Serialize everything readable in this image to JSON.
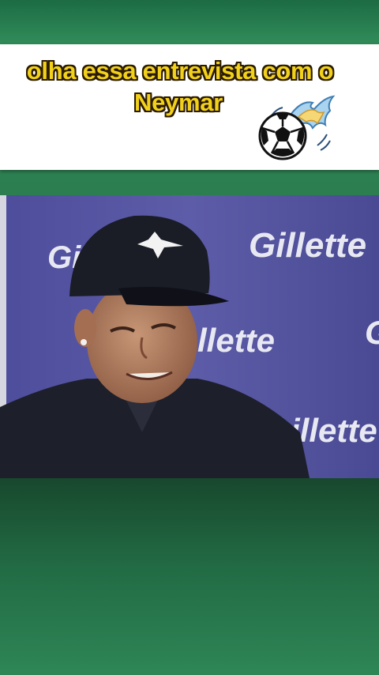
{
  "caption": {
    "line1": "olha essa entrevista com o",
    "line2": "Neymar"
  },
  "icons": {
    "ball": "soccer-ball-flame-icon"
  },
  "video": {
    "brand_text": "Gillette",
    "brand_text_partial_left": "Gi",
    "brand_text_partial_mid": "llette",
    "brand_text_partial_bottom": "illette",
    "brand_text_partial_right": "G"
  },
  "colors": {
    "caption_text": "#f2d11c",
    "caption_outline": "#2a1a00",
    "background_green": "#2c7d50",
    "backdrop_blue": "#5a5aa0"
  }
}
